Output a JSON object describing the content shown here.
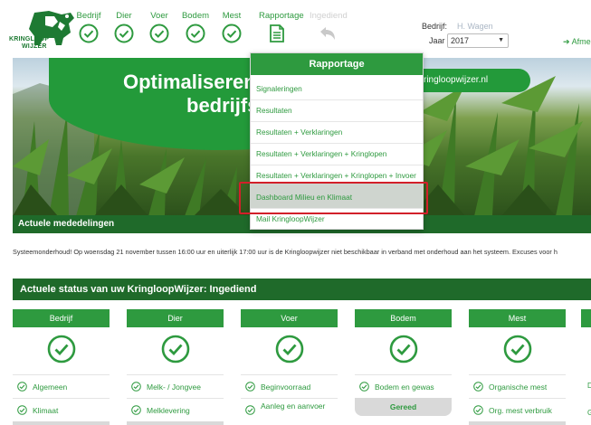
{
  "brand": {
    "logo_text_line1": "KRINGLOOP",
    "logo_text_line2": "WIJZER",
    "accent_color": "#2e9a3f",
    "dark_green": "#1f6a2a",
    "highlight_red": "#d2202a"
  },
  "nav": {
    "steps": [
      {
        "label": "Bedrijf",
        "icon": "check-circle-icon",
        "state": "done"
      },
      {
        "label": "Dier",
        "icon": "check-circle-icon",
        "state": "done"
      },
      {
        "label": "Voer",
        "icon": "check-circle-icon",
        "state": "done"
      },
      {
        "label": "Bodem",
        "icon": "check-circle-icon",
        "state": "done"
      },
      {
        "label": "Mest",
        "icon": "check-circle-icon",
        "state": "done"
      },
      {
        "label": "Rapportage",
        "icon": "document-icon",
        "state": "active"
      },
      {
        "label": "Ingediend",
        "icon": "undo-arrow-icon",
        "state": "disabled"
      }
    ]
  },
  "header": {
    "bedrijf_label": "Bedrijf:",
    "bedrijf_value": "H. Wagen",
    "jaar_label": "Jaar",
    "jaar_value": "2017",
    "afmelden_label": "Afme"
  },
  "hero": {
    "title_line1": "Optimaliseren",
    "title_line2": "bedrijfs",
    "url": "ringloopwijzer.nl"
  },
  "dropdown": {
    "header": "Rapportage",
    "items": [
      "Signaleringen",
      "Resultaten",
      "Resultaten + Verklaringen",
      "Resultaten + Verklaringen + Kringlopen",
      "Resultaten + Verklaringen + Kringlopen + Invoer",
      "Dashboard Milieu en Klimaat",
      "Mail KringloopWijzer"
    ],
    "highlighted_index": 5
  },
  "mededelingen": {
    "title": "Actuele mededelingen",
    "notice": "Systeemonderhoud! Op woensdag 21 november tussen 16:00 uur en uiterlijk 17:00 uur is de Kringloopwijzer niet beschikbaar in verband met onderhoud aan het systeem. Excuses voor h"
  },
  "status": {
    "title": "Actuele status van uw KringloopWijzer: Ingediend",
    "cards": [
      {
        "title": "Bedrijf",
        "rows": [
          "Algemeen",
          "Klimaat"
        ]
      },
      {
        "title": "Dier",
        "rows": [
          "Melk- / Jongvee",
          "Melklevering"
        ]
      },
      {
        "title": "Voer",
        "rows": [
          "Beginvoorraad",
          "Aanleg en aanvoer"
        ]
      },
      {
        "title": "Bodem",
        "rows": [
          "Bodem en gewas"
        ],
        "footer": "Gereed"
      },
      {
        "title": "Mest",
        "rows": [
          "Organische mest",
          "Org. mest verbruik"
        ]
      }
    ],
    "stub_texts": [
      "D",
      "G"
    ]
  }
}
